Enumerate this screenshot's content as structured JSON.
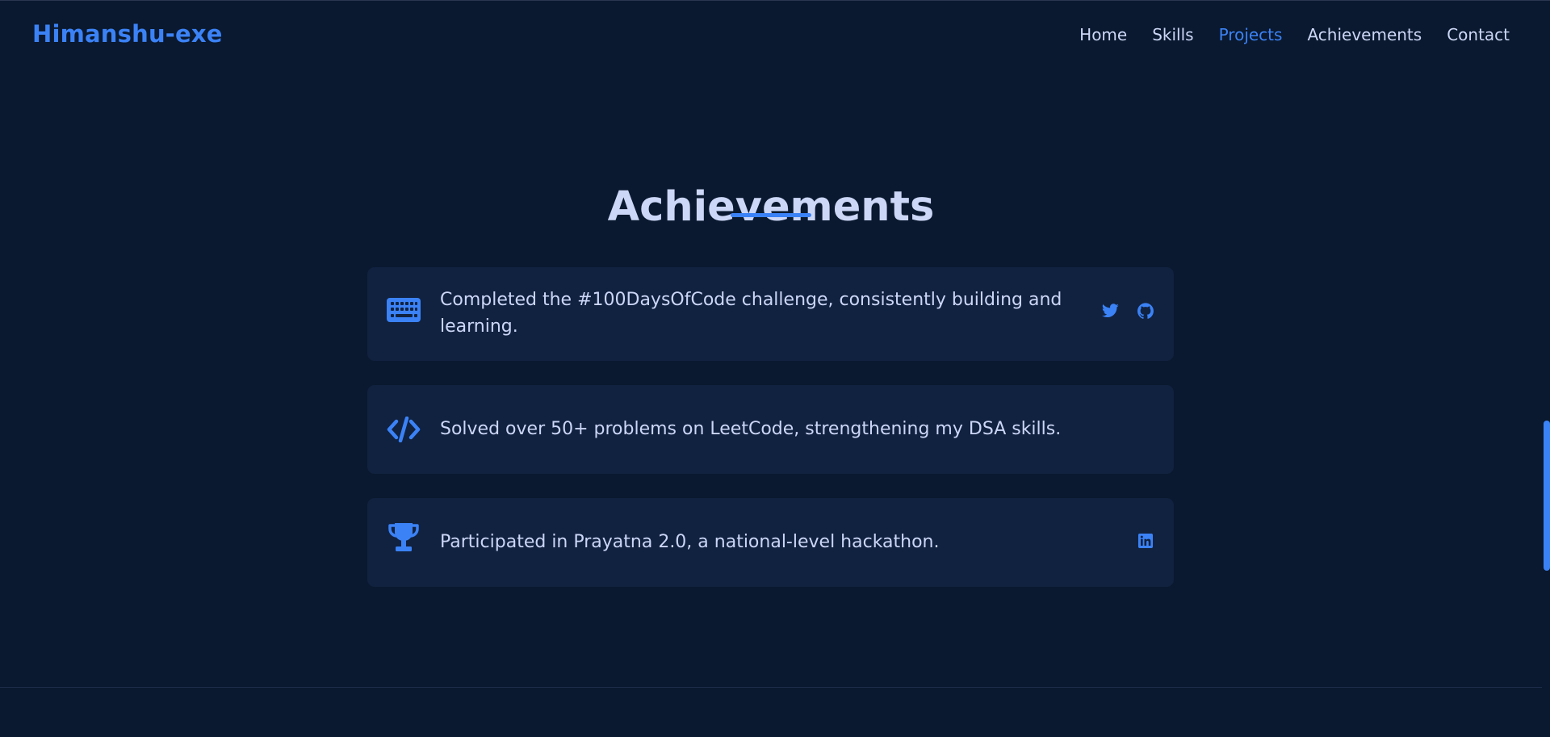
{
  "header": {
    "logo": "Himanshu-exe",
    "nav": [
      {
        "label": "Home",
        "active": false
      },
      {
        "label": "Skills",
        "active": false
      },
      {
        "label": "Projects",
        "active": true
      },
      {
        "label": "Achievements",
        "active": false
      },
      {
        "label": "Contact",
        "active": false
      }
    ]
  },
  "achievements": {
    "title": "Achievements",
    "items": [
      {
        "icon": "keyboard-icon",
        "text": "Completed the #100DaysOfCode challenge, consistently building and learning.",
        "links": [
          "twitter-icon",
          "github-icon"
        ]
      },
      {
        "icon": "code-icon",
        "text": "Solved over 50+ problems on LeetCode, strengthening my DSA skills.",
        "links": []
      },
      {
        "icon": "trophy-icon",
        "text": "Participated in Prayatna 2.0, a national-level hackathon.",
        "links": [
          "linkedin-icon"
        ]
      }
    ]
  },
  "colors": {
    "background": "#0a192f",
    "card": "#112240",
    "accent": "#3b82f6",
    "text": "#ccd6f6"
  }
}
